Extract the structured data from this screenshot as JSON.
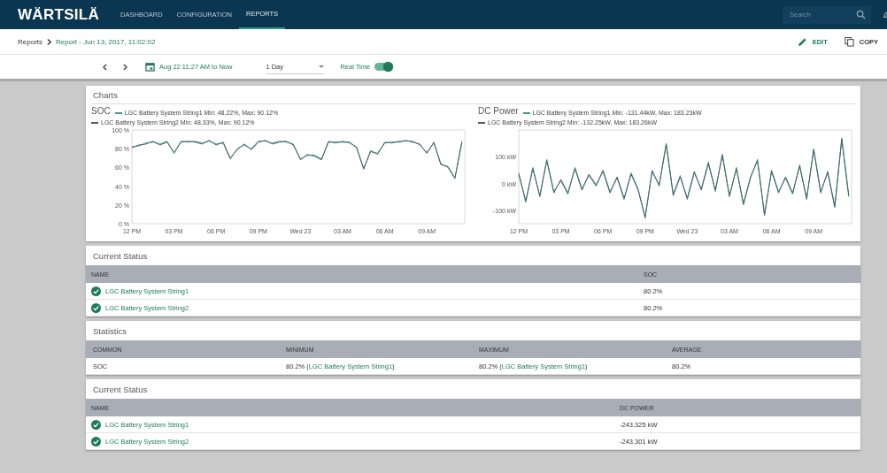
{
  "nav": {
    "logo": "WÄRTSILÄ",
    "tabs": [
      {
        "label": "DASHBOARD",
        "selected": false
      },
      {
        "label": "CONFIGURATION",
        "selected": false
      },
      {
        "label": "REPORTS",
        "selected": true
      }
    ],
    "search": {
      "placeholder": "Search"
    }
  },
  "breadcrumb": {
    "parent": "Reports",
    "current": "Report - Jun 13, 2017, 11:02:02"
  },
  "actions": [
    {
      "kind": "edit",
      "label": "EDIT"
    },
    {
      "kind": "copy",
      "label": "COPY"
    }
  ],
  "toolbar": {
    "range": "Aug 22 11:27 AM to Now",
    "period": "1 Day",
    "realtime_label": "Real Time",
    "realtime_on": true
  },
  "charts_card": {
    "title": "Charts",
    "charts": [
      {
        "chart_data": {
          "type": "line",
          "title": "SOC",
          "legend": true,
          "xlim": [
            "2017-08-22T12:00",
            "2017-08-23T11:42"
          ],
          "ylim": [
            0,
            100
          ],
          "x": [
            "2017-08-22T12:00",
            "2017-08-22T12:30",
            "2017-08-22T13:00",
            "2017-08-22T13:30",
            "2017-08-22T14:00",
            "2017-08-22T14:30",
            "2017-08-22T15:00",
            "2017-08-22T15:30",
            "2017-08-22T16:00",
            "2017-08-22T16:30",
            "2017-08-22T17:00",
            "2017-08-22T17:30",
            "2017-08-22T18:00",
            "2017-08-22T18:30",
            "2017-08-22T19:00",
            "2017-08-22T19:30",
            "2017-08-22T20:00",
            "2017-08-22T20:30",
            "2017-08-22T21:00",
            "2017-08-22T21:30",
            "2017-08-22T22:00",
            "2017-08-22T22:30",
            "2017-08-22T23:00",
            "2017-08-22T23:30",
            "2017-08-23T00:00",
            "2017-08-23T00:30",
            "2017-08-23T01:00",
            "2017-08-23T01:30",
            "2017-08-23T02:00",
            "2017-08-23T02:30",
            "2017-08-23T03:00",
            "2017-08-23T03:30",
            "2017-08-23T04:00",
            "2017-08-23T04:30",
            "2017-08-23T05:00",
            "2017-08-23T05:30",
            "2017-08-23T06:00",
            "2017-08-23T06:30",
            "2017-08-23T07:00",
            "2017-08-23T07:30",
            "2017-08-23T08:00",
            "2017-08-23T08:30",
            "2017-08-23T09:00",
            "2017-08-23T09:30",
            "2017-08-23T10:00",
            "2017-08-23T10:30",
            "2017-08-23T11:00",
            "2017-08-23T11:30"
          ],
          "xticks": [
            {
              "value": "2017-08-22T12:00",
              "label": "12 PM"
            },
            {
              "value": "2017-08-22T15:00",
              "label": "03 PM"
            },
            {
              "value": "2017-08-22T18:00",
              "label": "06 PM"
            },
            {
              "value": "2017-08-22T21:00",
              "label": "09 PM"
            },
            {
              "value": "2017-08-23T00:00",
              "label": "Wed 23"
            },
            {
              "value": "2017-08-23T03:00",
              "label": "03 AM"
            },
            {
              "value": "2017-08-23T06:00",
              "label": "06 AM"
            },
            {
              "value": "2017-08-23T09:00",
              "label": "09 AM"
            }
          ],
          "yticks": [
            {
              "value": 0,
              "label": "0 %"
            },
            {
              "value": 20,
              "label": "20 %"
            },
            {
              "value": 40,
              "label": "40 %"
            },
            {
              "value": 60,
              "label": "60 %"
            },
            {
              "value": 80,
              "label": "80 %"
            },
            {
              "value": 100,
              "label": "100 %"
            }
          ],
          "series": [
            {
              "name": "LGC Battery System String1 Min: 48.22%, Max: 90.12%",
              "color": "#3f9a8c",
              "values": [
                82,
                83,
                86,
                87,
                85,
                88,
                75,
                88,
                87,
                88,
                86,
                88,
                85,
                86,
                69,
                80,
                84,
                80,
                88,
                88,
                86,
                88,
                87,
                85,
                68,
                74,
                72,
                68,
                88,
                86,
                88,
                86,
                82,
                58,
                78,
                74,
                87,
                86,
                88,
                88,
                88,
                84,
                76,
                86,
                64,
                60,
                48,
                88
              ]
            },
            {
              "name": "LGC Battery System String2 Min: 48.33%, Max: 90.12%",
              "color": "#4a5f66",
              "values": [
                81,
                84,
                85,
                88,
                84,
                87,
                76,
                87,
                88,
                87,
                85,
                89,
                84,
                87,
                70,
                79,
                85,
                79,
                87,
                89,
                85,
                87,
                88,
                84,
                69,
                73,
                73,
                69,
                87,
                87,
                87,
                87,
                81,
                59,
                77,
                75,
                86,
                87,
                87,
                89,
                87,
                85,
                75,
                87,
                63,
                61,
                49,
                87
              ]
            }
          ]
        }
      },
      {
        "chart_data": {
          "type": "line",
          "title": "DC Power",
          "legend": true,
          "xlim": [
            "2017-08-22T12:00",
            "2017-08-23T11:42"
          ],
          "ylim": [
            -150,
            200
          ],
          "x": [
            "2017-08-22T12:00",
            "2017-08-22T12:30",
            "2017-08-22T13:00",
            "2017-08-22T13:30",
            "2017-08-22T14:00",
            "2017-08-22T14:30",
            "2017-08-22T15:00",
            "2017-08-22T15:30",
            "2017-08-22T16:00",
            "2017-08-22T16:30",
            "2017-08-22T17:00",
            "2017-08-22T17:30",
            "2017-08-22T18:00",
            "2017-08-22T18:30",
            "2017-08-22T19:00",
            "2017-08-22T19:30",
            "2017-08-22T20:00",
            "2017-08-22T20:30",
            "2017-08-22T21:00",
            "2017-08-22T21:30",
            "2017-08-22T22:00",
            "2017-08-22T22:30",
            "2017-08-22T23:00",
            "2017-08-22T23:30",
            "2017-08-23T00:00",
            "2017-08-23T00:30",
            "2017-08-23T01:00",
            "2017-08-23T01:30",
            "2017-08-23T02:00",
            "2017-08-23T02:30",
            "2017-08-23T03:00",
            "2017-08-23T03:30",
            "2017-08-23T04:00",
            "2017-08-23T04:30",
            "2017-08-23T05:00",
            "2017-08-23T05:30",
            "2017-08-23T06:00",
            "2017-08-23T06:30",
            "2017-08-23T07:00",
            "2017-08-23T07:30",
            "2017-08-23T08:00",
            "2017-08-23T08:30",
            "2017-08-23T09:00",
            "2017-08-23T09:30",
            "2017-08-23T10:00",
            "2017-08-23T10:30",
            "2017-08-23T11:00",
            "2017-08-23T11:30"
          ],
          "xticks": [
            {
              "value": "2017-08-22T12:00",
              "label": "12 PM"
            },
            {
              "value": "2017-08-22T15:00",
              "label": "03 PM"
            },
            {
              "value": "2017-08-22T18:00",
              "label": "06 PM"
            },
            {
              "value": "2017-08-22T21:00",
              "label": "09 PM"
            },
            {
              "value": "2017-08-23T00:00",
              "label": "Wed 23"
            },
            {
              "value": "2017-08-23T03:00",
              "label": "03 AM"
            },
            {
              "value": "2017-08-23T06:00",
              "label": "06 AM"
            },
            {
              "value": "2017-08-23T09:00",
              "label": "09 AM"
            }
          ],
          "yticks": [
            {
              "value": -100,
              "label": "-100 kW"
            },
            {
              "value": 0,
              "label": "0 kW"
            },
            {
              "value": 100,
              "label": "100 kW"
            }
          ],
          "series": [
            {
              "name": "LGC Battery System String1 Min: -131.44kW, Max: 183.23kW",
              "color": "#3f9a8c",
              "values": [
                40,
                -70,
                60,
                -50,
                90,
                -30,
                10,
                -40,
                60,
                -20,
                30,
                -10,
                50,
                -30,
                20,
                -60,
                40,
                -20,
                -130,
                50,
                -10,
                150,
                -40,
                30,
                -60,
                40,
                -20,
                80,
                -30,
                110,
                -50,
                60,
                -80,
                20,
                90,
                -120,
                50,
                -30,
                20,
                -40,
                70,
                -60,
                130,
                -30,
                40,
                -90,
                170,
                -50
              ]
            },
            {
              "name": "LGC Battery System String2 Min: -132.25kW, Max: 183.26kW",
              "color": "#4a5f66",
              "values": [
                35,
                -65,
                55,
                -45,
                85,
                -35,
                15,
                -35,
                55,
                -25,
                35,
                -5,
                45,
                -35,
                25,
                -55,
                35,
                -25,
                -125,
                45,
                -5,
                145,
                -45,
                25,
                -55,
                45,
                -25,
                75,
                -25,
                105,
                -45,
                55,
                -75,
                25,
                85,
                -115,
                45,
                -35,
                25,
                -35,
                65,
                -55,
                125,
                -35,
                45,
                -85,
                165,
                -45
              ]
            }
          ]
        }
      }
    ]
  },
  "status_soc": {
    "title": "Current Status",
    "columns": [
      "NAME",
      "SOC"
    ],
    "rows": [
      {
        "healthy": true,
        "name": "LGC Battery System String1",
        "value": "80.2%"
      },
      {
        "healthy": true,
        "name": "LGC Battery System String2",
        "value": "80.2%"
      }
    ]
  },
  "statistics": {
    "title": "Statistics",
    "columns": [
      "COMMON",
      "MINIMUM",
      "MAXIMUM",
      "AVERAGE"
    ],
    "rows": [
      {
        "common": "SOC",
        "minimum": {
          "text": "80.2% (",
          "link": "LGC Battery System String1",
          "after": ")"
        },
        "maximum": {
          "text": "80.2% (",
          "link": "LGC Battery System String1",
          "after": ")"
        },
        "average": "80.2%"
      }
    ]
  },
  "status_dc": {
    "title": "Current Status",
    "columns": [
      "NAME",
      "DC POWER"
    ],
    "rows": [
      {
        "healthy": true,
        "name": "LGC Battery System String1",
        "value": "-243.325 kW"
      },
      {
        "healthy": true,
        "name": "LGC Battery System String2",
        "value": "-243.301 kW"
      }
    ]
  }
}
